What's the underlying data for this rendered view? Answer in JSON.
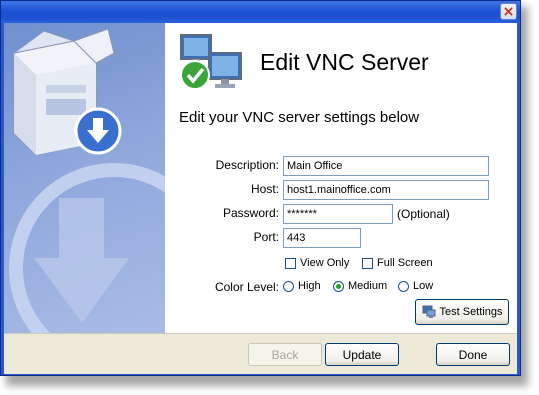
{
  "window": {
    "close_icon": "close-icon"
  },
  "header": {
    "title": "Edit VNC Server",
    "subtitle": "Edit your VNC server settings below",
    "icon": "monitors-check-icon"
  },
  "form": {
    "description_label": "Description:",
    "description_value": "Main Office",
    "host_label": "Host:",
    "host_value": "host1.mainoffice.com",
    "password_label": "Password:",
    "password_value": "*******",
    "password_hint": "(Optional)",
    "port_label": "Port:",
    "port_value": "443",
    "view_only_label": "View Only",
    "full_screen_label": "Full Screen",
    "color_level_label": "Color Level:",
    "color_options": [
      "High",
      "Medium",
      "Low"
    ],
    "color_selected": "Medium",
    "test_settings_label": "Test Settings"
  },
  "footer": {
    "back_label": "Back",
    "update_label": "Update",
    "done_label": "Done"
  }
}
